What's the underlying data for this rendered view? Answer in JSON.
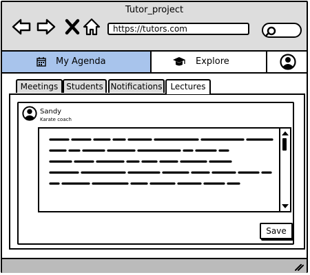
{
  "window": {
    "title": "Tutor_project"
  },
  "browser": {
    "url": "https://tutors.com",
    "icons": [
      "back-arrow-icon",
      "forward-arrow-icon",
      "close-icon",
      "home-icon",
      "search-icon"
    ]
  },
  "menu": {
    "agenda_label": "My Agenda",
    "explore_label": "Explore",
    "agenda_icon": "calendar-icon",
    "explore_icon": "graduation-cap-icon",
    "user_icon": "user-avatar-icon",
    "active_color": "#a8c4ec"
  },
  "tabs": [
    {
      "label": "Meetings",
      "active": false
    },
    {
      "label": "Students",
      "active": false
    },
    {
      "label": "Notifications",
      "active": false
    },
    {
      "label": "Lectures",
      "active": true
    }
  ],
  "lecture_card": {
    "author_name": "Sandy",
    "author_role": "Karate coach",
    "save_label": "Save"
  }
}
